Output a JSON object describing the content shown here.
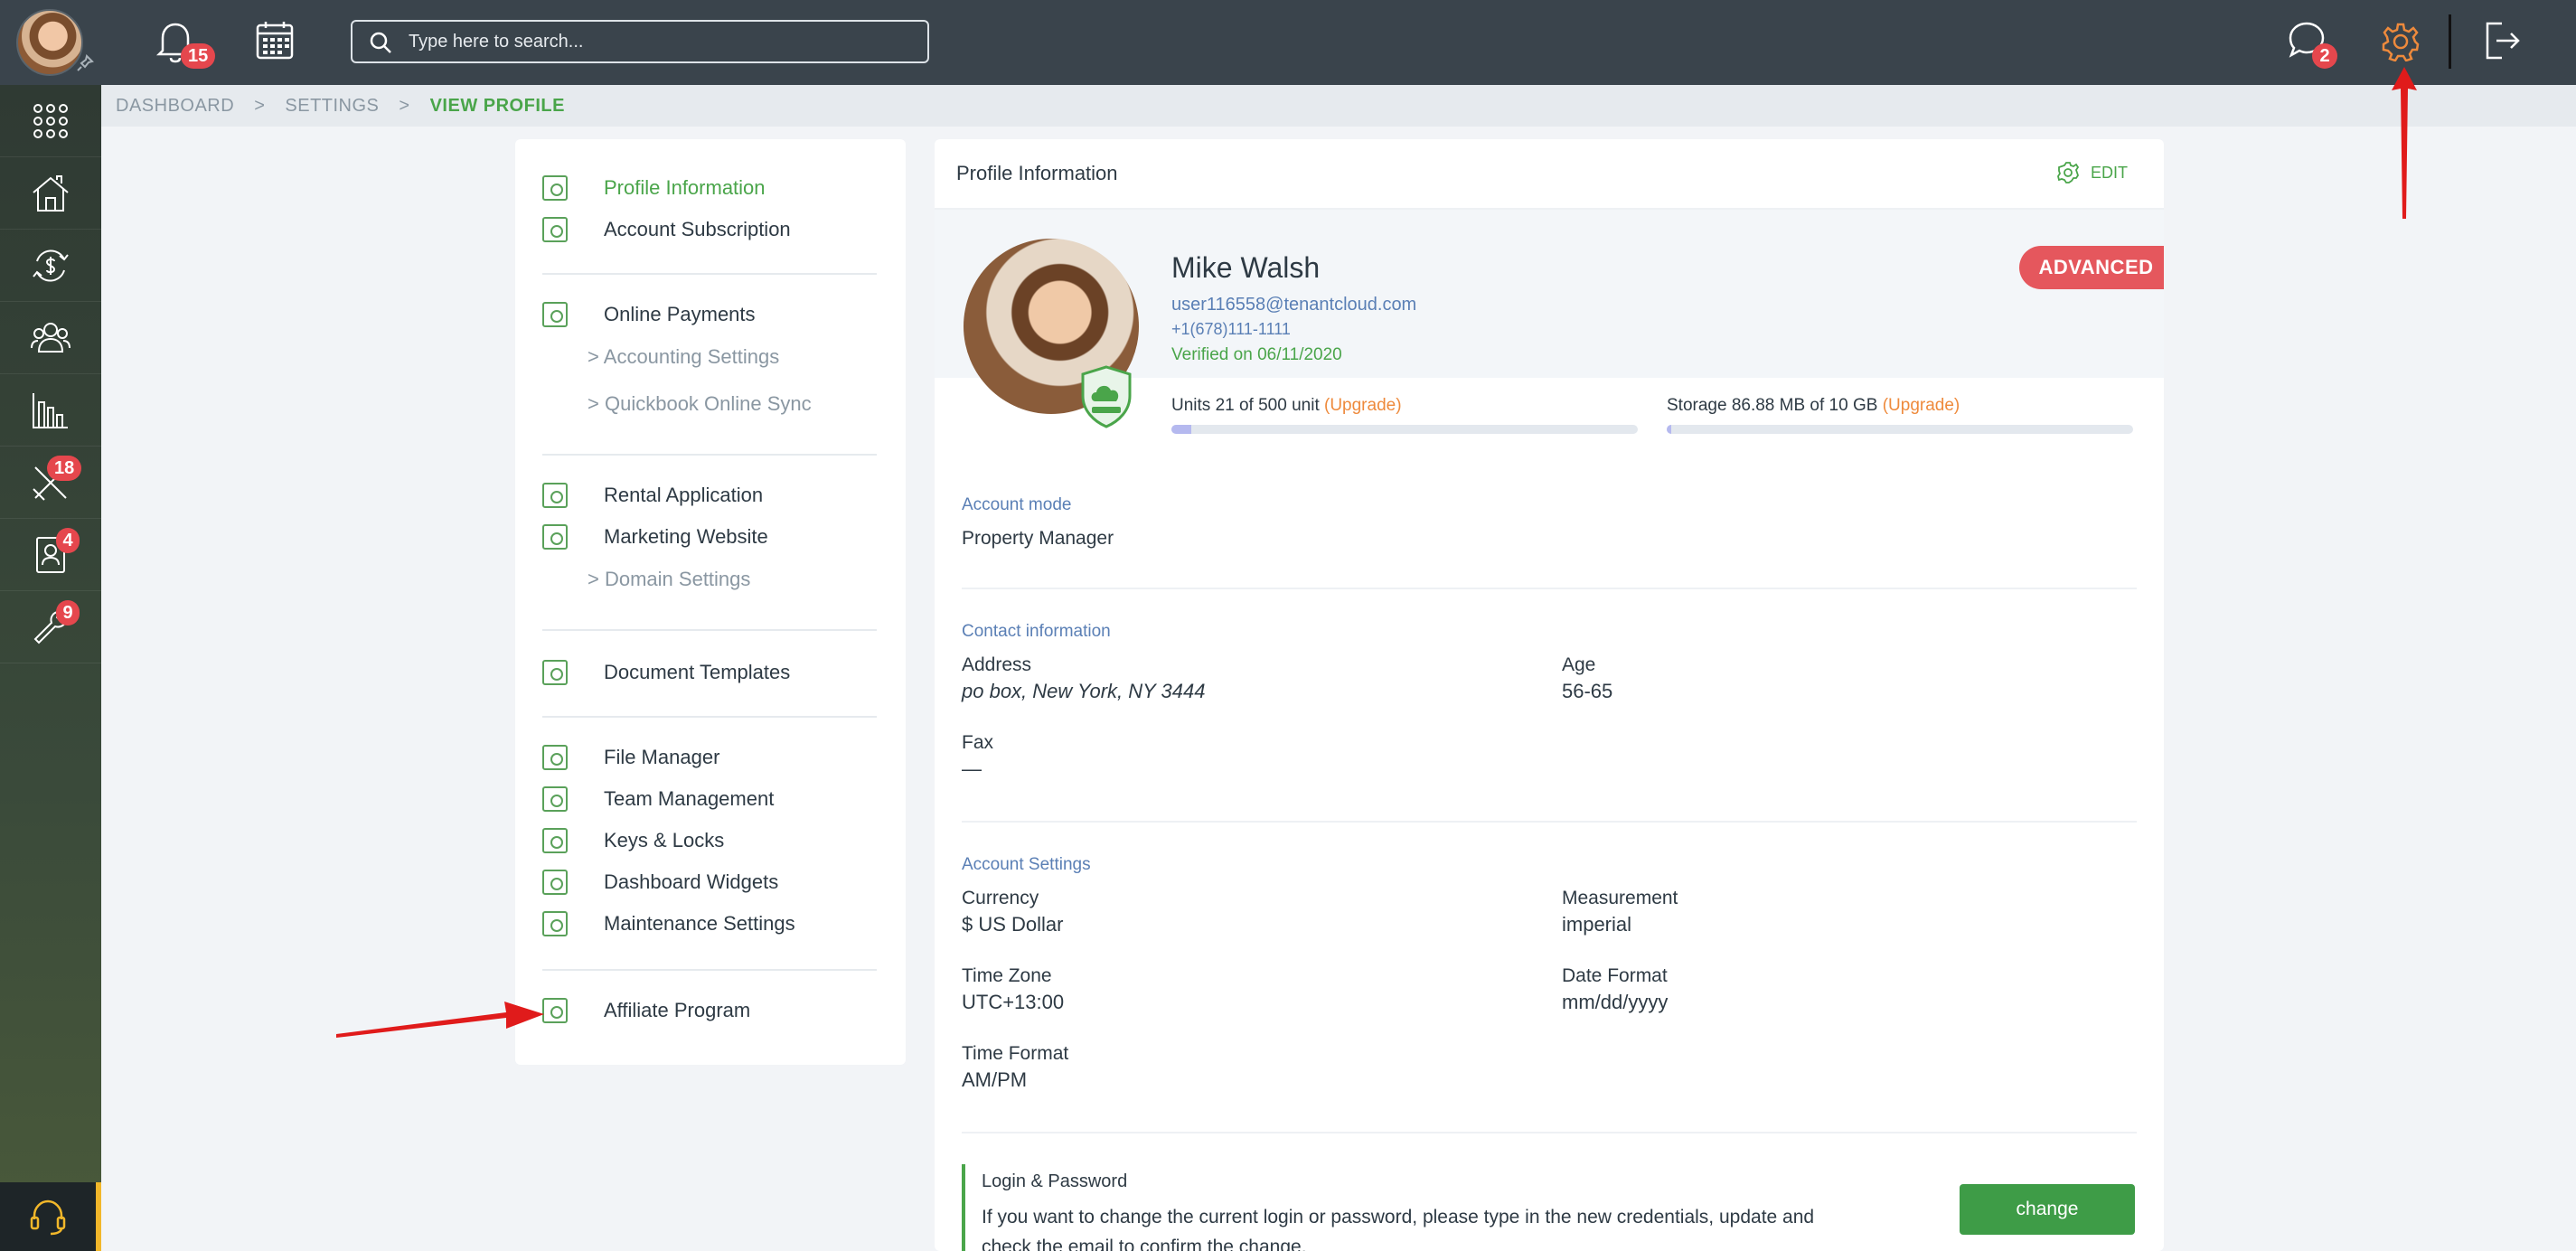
{
  "topbar": {
    "notifications_count": "15",
    "search_placeholder": "Type here to search...",
    "messages_count": "2"
  },
  "rail": {
    "badges": {
      "tools": "18",
      "contacts": "4",
      "maintenance": "9"
    }
  },
  "breadcrumb": {
    "items": [
      "DASHBOARD",
      "SETTINGS",
      "VIEW PROFILE"
    ],
    "separator": ">"
  },
  "menu": {
    "profile_information": "Profile Information",
    "account_subscription": "Account Subscription",
    "online_payments": "Online Payments",
    "accounting_settings": "Accounting Settings",
    "quickbook_sync": "Quickbook Online Sync",
    "rental_application": "Rental Application",
    "marketing_website": "Marketing Website",
    "domain_settings": "Domain Settings",
    "document_templates": "Document Templates",
    "file_manager": "File Manager",
    "team_management": "Team Management",
    "keys_locks": "Keys & Locks",
    "dashboard_widgets": "Dashboard Widgets",
    "maintenance_settings": "Maintenance Settings",
    "affiliate_program": "Affiliate Program",
    "sub_arrow": ">"
  },
  "profile": {
    "header_title": "Profile Information",
    "edit_label": "EDIT",
    "name": "Mike Walsh",
    "email": "user116558@tenantcloud.com",
    "phone": "+1(678)111-1111",
    "verified": "Verified on 06/11/2020",
    "plan_badge": "ADVANCED",
    "units_text": "Units 21 of 500 unit",
    "units_fraction": 0.042,
    "storage_text": "Storage 86.88 MB of 10 GB",
    "storage_fraction": 0.0087,
    "upgrade_label": "(Upgrade)"
  },
  "account_mode": {
    "section": "Account mode",
    "value": "Property Manager"
  },
  "contact": {
    "section": "Contact information",
    "address_label": "Address",
    "address_value": "po box, New York, NY 3444",
    "age_label": "Age",
    "age_value": "56-65",
    "fax_label": "Fax",
    "fax_value": "—"
  },
  "account_settings": {
    "section": "Account Settings",
    "currency_label": "Currency",
    "currency_value": "$ US Dollar",
    "measurement_label": "Measurement",
    "measurement_value": "imperial",
    "timezone_label": "Time Zone",
    "timezone_value": "UTC+13:00",
    "dateformat_label": "Date Format",
    "dateformat_value": "mm/dd/yyyy",
    "timeformat_label": "Time Format",
    "timeformat_value": "AM/PM"
  },
  "login": {
    "title": "Login & Password",
    "text": "If you want to change the current login or password, please type in the new credentials, update and check the email to confirm the change.",
    "button": "change"
  },
  "colors": {
    "accent_green": "#4aa54a",
    "badge_red": "#e5474d",
    "upgrade_orange": "#ee8a3c",
    "link_blue": "#5a7fb5",
    "arrow_red": "#e01b1b"
  }
}
